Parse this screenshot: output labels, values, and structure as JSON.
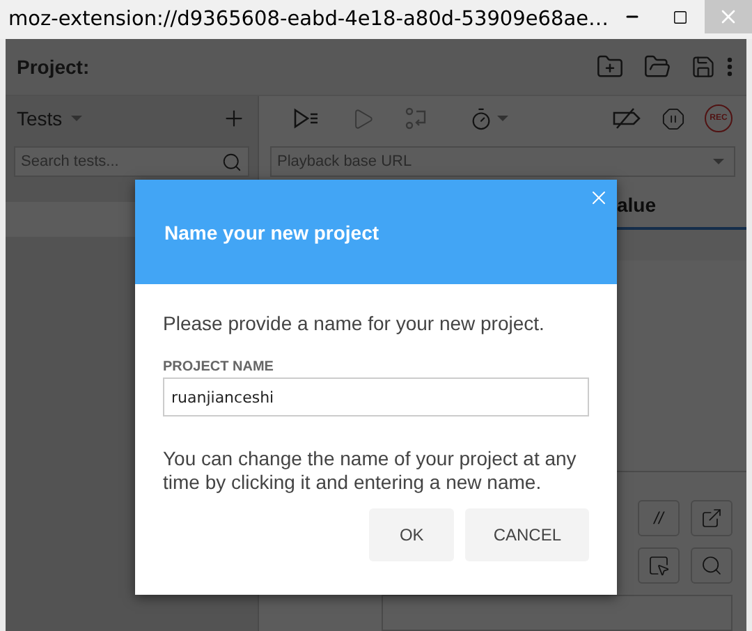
{
  "window": {
    "title": "moz-extension://d9365608-eabd-4e18-a80d-53909e68ae…"
  },
  "project": {
    "label": "Project:"
  },
  "tests_panel": {
    "title": "Tests",
    "search": {
      "placeholder": "Search tests..."
    }
  },
  "editor": {
    "rec_label": "REC",
    "base_url": {
      "placeholder": "Playback base URL"
    },
    "table": {
      "columns": [
        "alue"
      ]
    },
    "command_buttons": [
      "//"
    ]
  },
  "dialog": {
    "title": "Name your new project",
    "prompt": "Please provide a name for your new project.",
    "field": {
      "label": "PROJECT NAME",
      "value": "ruanjianceshi"
    },
    "note": "You can change the name of your project at any time by clicking it and entering a new name.",
    "buttons": [
      {
        "label": "OK"
      },
      {
        "label": "CANCEL"
      }
    ]
  }
}
